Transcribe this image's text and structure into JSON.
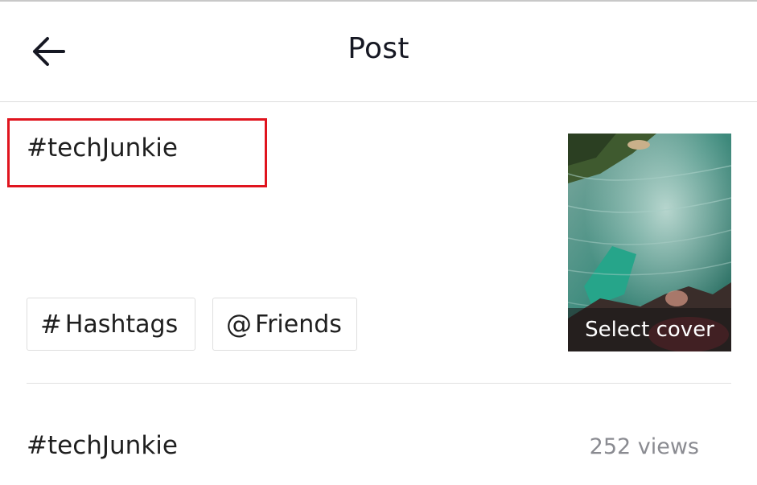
{
  "header": {
    "title": "Post",
    "back_icon": "arrow-left-icon"
  },
  "caption": {
    "value": "#techJunkie"
  },
  "chips": [
    {
      "symbol": "#",
      "label": "Hashtags"
    },
    {
      "symbol": "@",
      "label": "Friends"
    }
  ],
  "cover": {
    "label": "Select cover"
  },
  "suggestion": {
    "tag": "#techJunkie",
    "views": "252 views"
  },
  "colors": {
    "highlight_border": "#e0141e",
    "text": "#161823",
    "muted": "#8a8b91"
  }
}
